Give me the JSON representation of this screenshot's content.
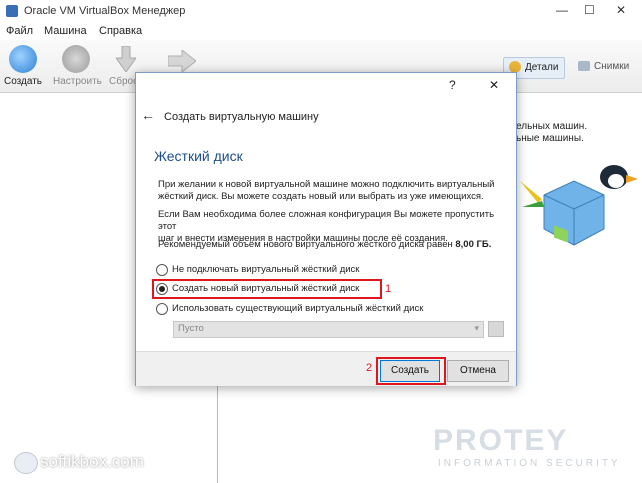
{
  "window": {
    "title": "Oracle VM VirtualBox Менеджер",
    "minimize": "—",
    "maximize": "☐",
    "close": "✕"
  },
  "menu": [
    "Файл",
    "Машина",
    "Справка"
  ],
  "toolbar": {
    "create": "Создать",
    "configure": "Настроить",
    "discard": "Сброс",
    "details": "Детали",
    "snapshots": "Снимки"
  },
  "welcome_text": [
    "ельных машин.",
    "ьные машины."
  ],
  "dialog": {
    "help": "?",
    "close": "✕",
    "back_arrow": "←",
    "title": "Создать виртуальную машину",
    "heading": "Жесткий диск",
    "para1": [
      "При желании к новой виртуальной машине можно подключить виртуальный",
      "жёсткий диск. Вы можете создать новый или выбрать из уже имеющихся."
    ],
    "para2": [
      "Если Вам необходима более сложная конфигурация Вы можете пропустить этот",
      "шаг и внести изменения в настройки машины после её создания."
    ],
    "para3_prefix": "Рекомендуемый объём нового виртуального жёсткого диска равен ",
    "para3_value": "8,00 ГБ.",
    "options": [
      {
        "label": "Не подключать виртуальный жёсткий диск",
        "selected": false
      },
      {
        "label": "Создать новый виртуальный жёсткий диск",
        "selected": true
      },
      {
        "label": "Использовать существующий виртуальный жёсткий диск",
        "selected": false
      }
    ],
    "combo_value": "Пусто",
    "create_button": "Создать",
    "cancel_button": "Отмена",
    "marker1": "1",
    "marker2": "2"
  },
  "watermarks": {
    "softikbox": "softikbox.com",
    "protey": "PROTEY",
    "protey_sub": "INFORMATION SECURITY"
  },
  "colors": {
    "accent": "#0078d7",
    "highlight_red": "#e0161e",
    "heading_blue": "#1e4e8c"
  }
}
